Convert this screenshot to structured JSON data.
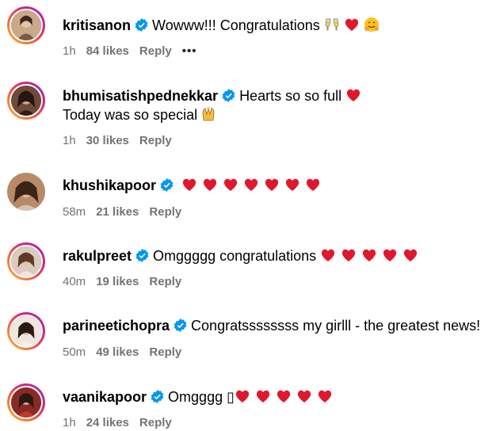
{
  "comments": [
    {
      "user": "kritisanon",
      "text": "Wowww!!! Congratulations",
      "emojis": [
        "clink-emoji",
        "heart-emoji",
        "hug-emoji"
      ],
      "time": "1h",
      "likes": "84 likes",
      "reply": "Reply",
      "more": "•••"
    },
    {
      "user": "bhumisatishpednekkar",
      "text": "Hearts so so full",
      "emojis": [
        "heart-emoji"
      ],
      "text2": "Today was so special",
      "emojis2": [
        "raised-hands-emoji"
      ],
      "time": "1h",
      "likes": "30 likes",
      "reply": "Reply"
    },
    {
      "user": "khushikapoor",
      "text": "",
      "emojis": [
        "heart",
        "heart",
        "heart",
        "heart",
        "heart",
        "heart",
        "heart"
      ],
      "time": "58m",
      "likes": "21 likes",
      "reply": "Reply"
    },
    {
      "user": "rakulpreet",
      "text": "Omggggg congratulations",
      "emojis": [
        "heart",
        "heart",
        "heart",
        "heart",
        "heart"
      ],
      "time": "40m",
      "likes": "19 likes",
      "reply": "Reply"
    },
    {
      "user": "parineetichopra",
      "text": "Congratssssssss my girlll - the greatest news!",
      "emojis": [],
      "time": "50m",
      "likes": "49 likes",
      "reply": "Reply"
    },
    {
      "user": "vaanikapoor",
      "text": "Omgggg ▯",
      "emojis": [
        "heart",
        "heart",
        "heart",
        "heart",
        "heart"
      ],
      "time": "1h",
      "likes": "24 likes",
      "reply": "Reply"
    }
  ],
  "colors": {
    "heart": "#e0182d",
    "verified": "#0095f6",
    "meta": "#737373"
  }
}
